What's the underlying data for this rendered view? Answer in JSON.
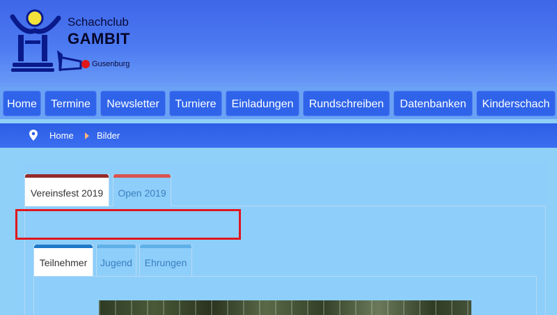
{
  "logo": {
    "line1": "Schachclub",
    "line2": "GAMBIT",
    "line3": "Gusenburg"
  },
  "nav": {
    "items": [
      {
        "label": "Home"
      },
      {
        "label": "Termine"
      },
      {
        "label": "Newsletter"
      },
      {
        "label": "Turniere"
      },
      {
        "label": "Einladungen"
      },
      {
        "label": "Rundschreiben"
      },
      {
        "label": "Datenbanken"
      },
      {
        "label": "Kinderschach"
      }
    ]
  },
  "breadcrumb": {
    "icon": "map-pin-icon",
    "home": "Home",
    "current": "Bilder"
  },
  "tabs": {
    "main": [
      {
        "label": "Vereinsfest 2019",
        "active": true,
        "accent": "#962a2a"
      },
      {
        "label": "Open 2019",
        "active": false,
        "accent": "#d9534f"
      }
    ],
    "sub": [
      {
        "label": "Teilnehmer",
        "active": true,
        "accent": "#1e78c8"
      },
      {
        "label": "Jugend",
        "active": false,
        "accent": "#5fb0e8"
      },
      {
        "label": "Ehrungen",
        "active": false,
        "accent": "#5fb0e8"
      }
    ]
  },
  "colors": {
    "header": "#3e66e8",
    "nav_button": "#2f64ea",
    "breadcrumb_bar": "#2d5ee6",
    "content_bg": "#8ecefa",
    "highlight_box": "#e0161c"
  }
}
